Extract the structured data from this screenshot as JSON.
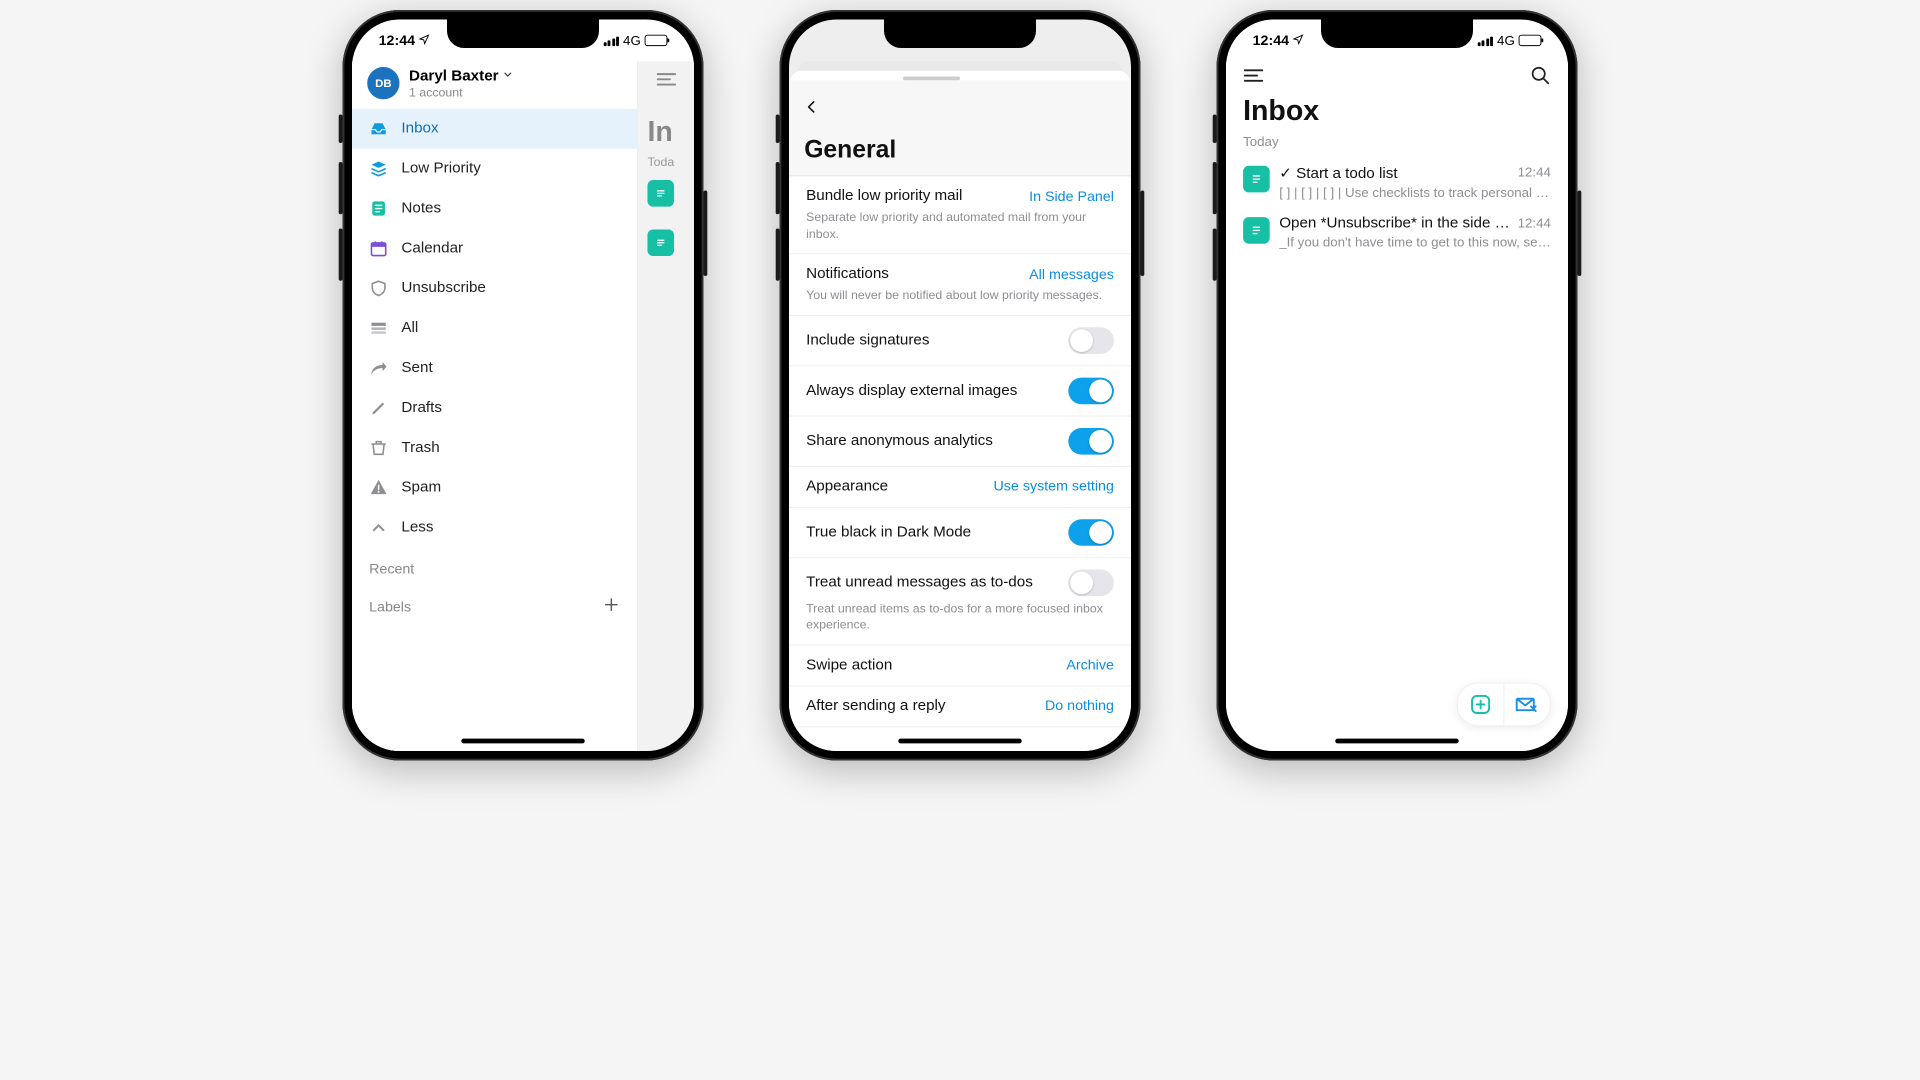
{
  "status": {
    "time": "12:44",
    "network": "4G"
  },
  "phone1": {
    "user": {
      "initials": "DB",
      "name": "Daryl Baxter",
      "sub": "1 account"
    },
    "nav": [
      {
        "id": "inbox",
        "label": "Inbox",
        "icon": "inbox-icon",
        "color": "#0e9bde",
        "selected": true
      },
      {
        "id": "low-priority",
        "label": "Low Priority",
        "icon": "stack-icon",
        "color": "#0e9bde"
      },
      {
        "id": "notes",
        "label": "Notes",
        "icon": "note-icon",
        "color": "#17bfa4"
      },
      {
        "id": "calendar",
        "label": "Calendar",
        "icon": "calendar-icon",
        "color": "#7b4fd8"
      },
      {
        "id": "unsubscribe",
        "label": "Unsubscribe",
        "icon": "shield-icon",
        "color": "#8e8e93"
      },
      {
        "id": "all",
        "label": "All",
        "icon": "all-icon",
        "color": "#8e8e93"
      },
      {
        "id": "sent",
        "label": "Sent",
        "icon": "sent-icon",
        "color": "#8e8e93"
      },
      {
        "id": "drafts",
        "label": "Drafts",
        "icon": "draft-icon",
        "color": "#8e8e93"
      },
      {
        "id": "trash",
        "label": "Trash",
        "icon": "trash-icon",
        "color": "#8e8e93"
      },
      {
        "id": "spam",
        "label": "Spam",
        "icon": "spam-icon",
        "color": "#8e8e93"
      },
      {
        "id": "less",
        "label": "Less",
        "icon": "chevron-up-icon",
        "color": "#8e8e93"
      }
    ],
    "sections": {
      "recent": "Recent",
      "labels": "Labels"
    },
    "bg": {
      "title": "In",
      "section": "Toda"
    }
  },
  "phone2": {
    "title": "General",
    "rows": [
      {
        "label": "Bundle low priority mail",
        "value": "In Side Panel",
        "sub": "Separate low priority and automated mail from your inbox."
      },
      {
        "label": "Notifications",
        "value": "All messages",
        "sub": "You will never be notified about low priority messages."
      },
      {
        "label": "Include signatures",
        "toggle": false
      },
      {
        "label": "Always display external images",
        "toggle": true
      },
      {
        "label": "Share anonymous analytics",
        "toggle": true
      },
      {
        "label": "Appearance",
        "value": "Use system setting"
      },
      {
        "label": "True black in Dark Mode",
        "toggle": true
      },
      {
        "label": "Treat unread messages as to-dos",
        "toggle": false,
        "sub": "Treat unread items as to-dos for a more focused inbox experience."
      },
      {
        "label": "Swipe action",
        "value": "Archive"
      },
      {
        "label": "After sending a reply",
        "value": "Do nothing"
      }
    ]
  },
  "phone3": {
    "title": "Inbox",
    "section": "Today",
    "messages": [
      {
        "title": "✓ Start a todo list",
        "time": "12:44",
        "sub": "[ ] | [ ] | [ ] | Use checklists to track personal t…"
      },
      {
        "title": "Open *Unsubscribe* in the side pan…",
        "time": "12:44",
        "sub": "_If you don't have time to get to this now, set a…"
      }
    ]
  }
}
